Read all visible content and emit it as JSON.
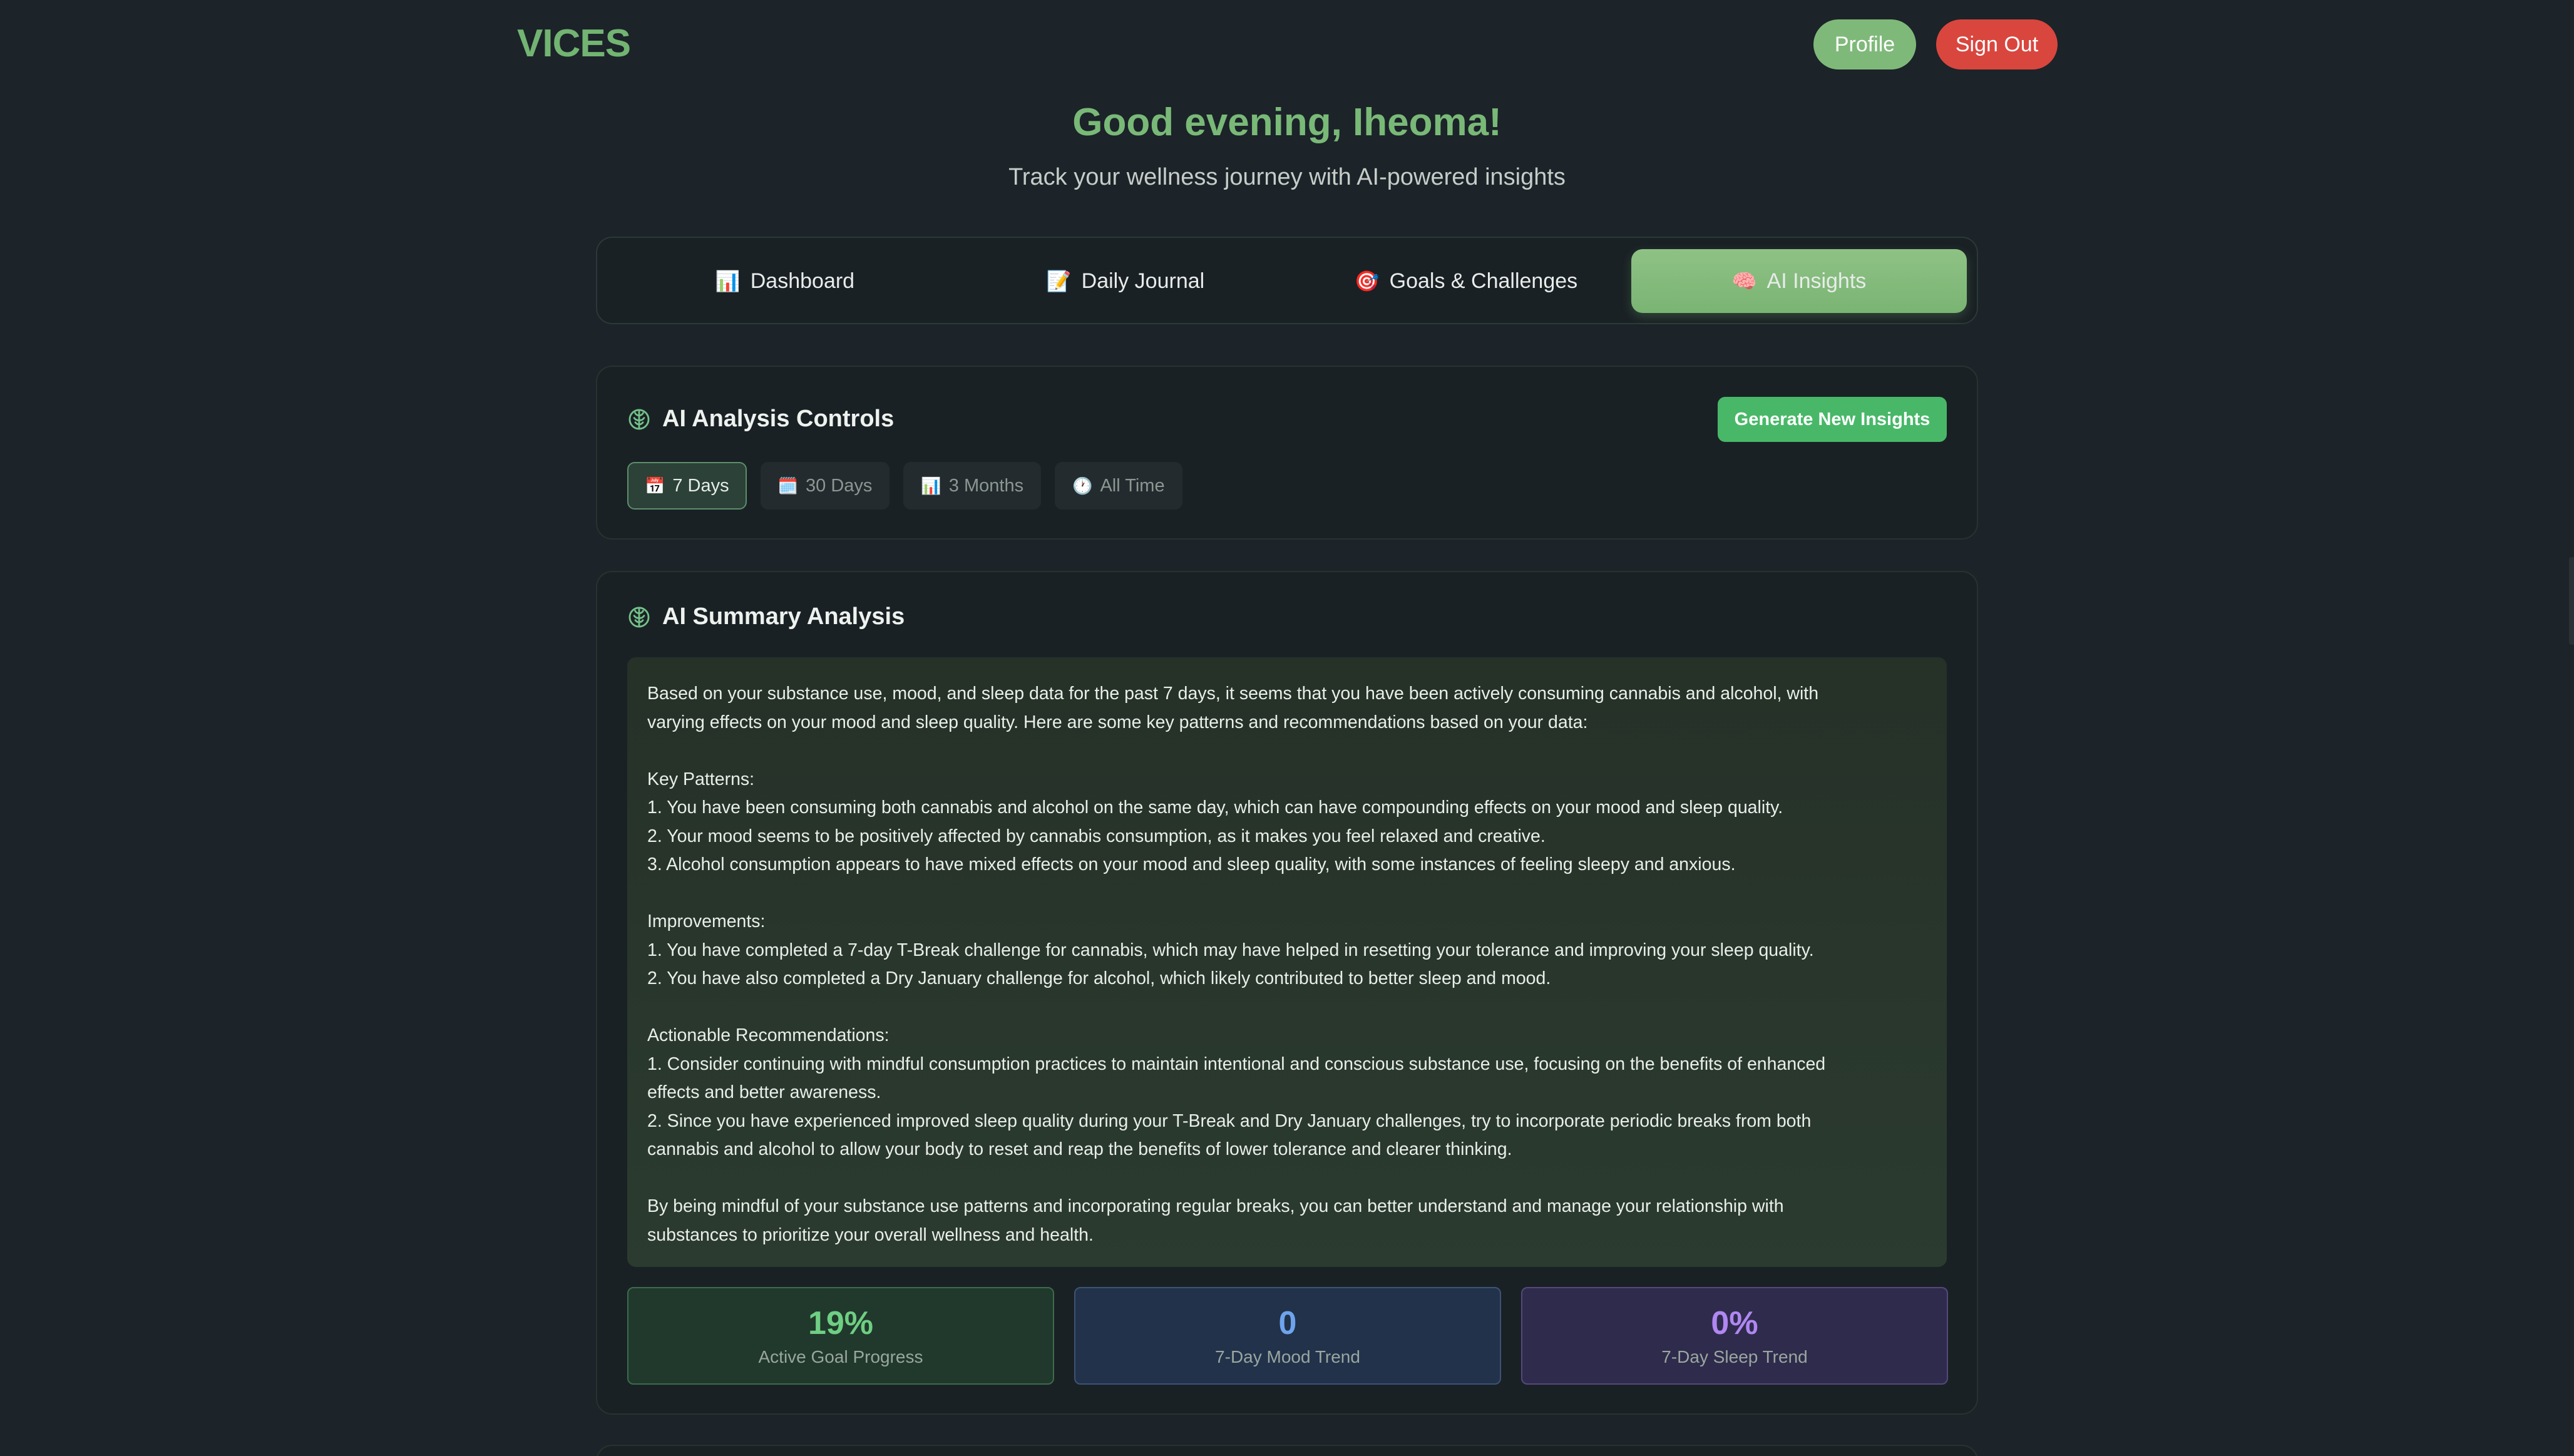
{
  "app": {
    "logo": "VICES",
    "profile_label": "Profile",
    "signout_label": "Sign Out"
  },
  "hero": {
    "greeting": "Good evening, Iheoma!",
    "subtitle": "Track your wellness journey with AI-powered insights"
  },
  "tabs": [
    {
      "icon": "📊",
      "label": "Dashboard",
      "active": false
    },
    {
      "icon": "📝",
      "label": "Daily Journal",
      "active": false
    },
    {
      "icon": "🎯",
      "label": "Goals & Challenges",
      "active": false
    },
    {
      "icon": "🧠",
      "label": "AI Insights",
      "active": true
    }
  ],
  "controls": {
    "title": "AI Analysis Controls",
    "generate_label": "Generate New Insights",
    "ranges": [
      {
        "icon": "📅",
        "label": "7 Days",
        "active": true
      },
      {
        "icon": "🗓️",
        "label": "30 Days",
        "active": false
      },
      {
        "icon": "📊",
        "label": "3 Months",
        "active": false
      },
      {
        "icon": "🕐",
        "label": "All Time",
        "active": false
      }
    ]
  },
  "summary": {
    "title": "AI Summary Analysis",
    "text": "Based on your substance use, mood, and sleep data for the past 7 days, it seems that you have been actively consuming cannabis and alcohol, with\nvarying effects on your mood and sleep quality. Here are some key patterns and recommendations based on your data:\n\nKey Patterns:\n1. You have been consuming both cannabis and alcohol on the same day, which can have compounding effects on your mood and sleep quality.\n2. Your mood seems to be positively affected by cannabis consumption, as it makes you feel relaxed and creative.\n3. Alcohol consumption appears to have mixed effects on your mood and sleep quality, with some instances of feeling sleepy and anxious.\n\nImprovements:\n1. You have completed a 7-day T-Break challenge for cannabis, which may have helped in resetting your tolerance and improving your sleep quality.\n2. You have also completed a Dry January challenge for alcohol, which likely contributed to better sleep and mood.\n\nActionable Recommendations:\n1. Consider continuing with mindful consumption practices to maintain intentional and conscious substance use, focusing on the benefits of enhanced\neffects and better awareness.\n2. Since you have experienced improved sleep quality during your T-Break and Dry January challenges, try to incorporate periodic breaks from both\ncannabis and alcohol to allow your body to reset and reap the benefits of lower tolerance and clearer thinking.\n\nBy being mindful of your substance use patterns and incorporating regular breaks, you can better understand and manage your relationship with\nsubstances to prioritize your overall wellness and health."
  },
  "stats": [
    {
      "value": "19%",
      "label": "Active Goal Progress",
      "color": "#6fce83"
    },
    {
      "value": "0",
      "label": "7-Day Mood Trend",
      "color": "#6ea4ee"
    },
    {
      "value": "0%",
      "label": "7-Day Sleep Trend",
      "color": "#b087f2"
    }
  ],
  "colors": {
    "accent_green": "#79b977",
    "signout_red": "#d9463e",
    "generate_green": "#48b868",
    "background": "#1c2329"
  }
}
